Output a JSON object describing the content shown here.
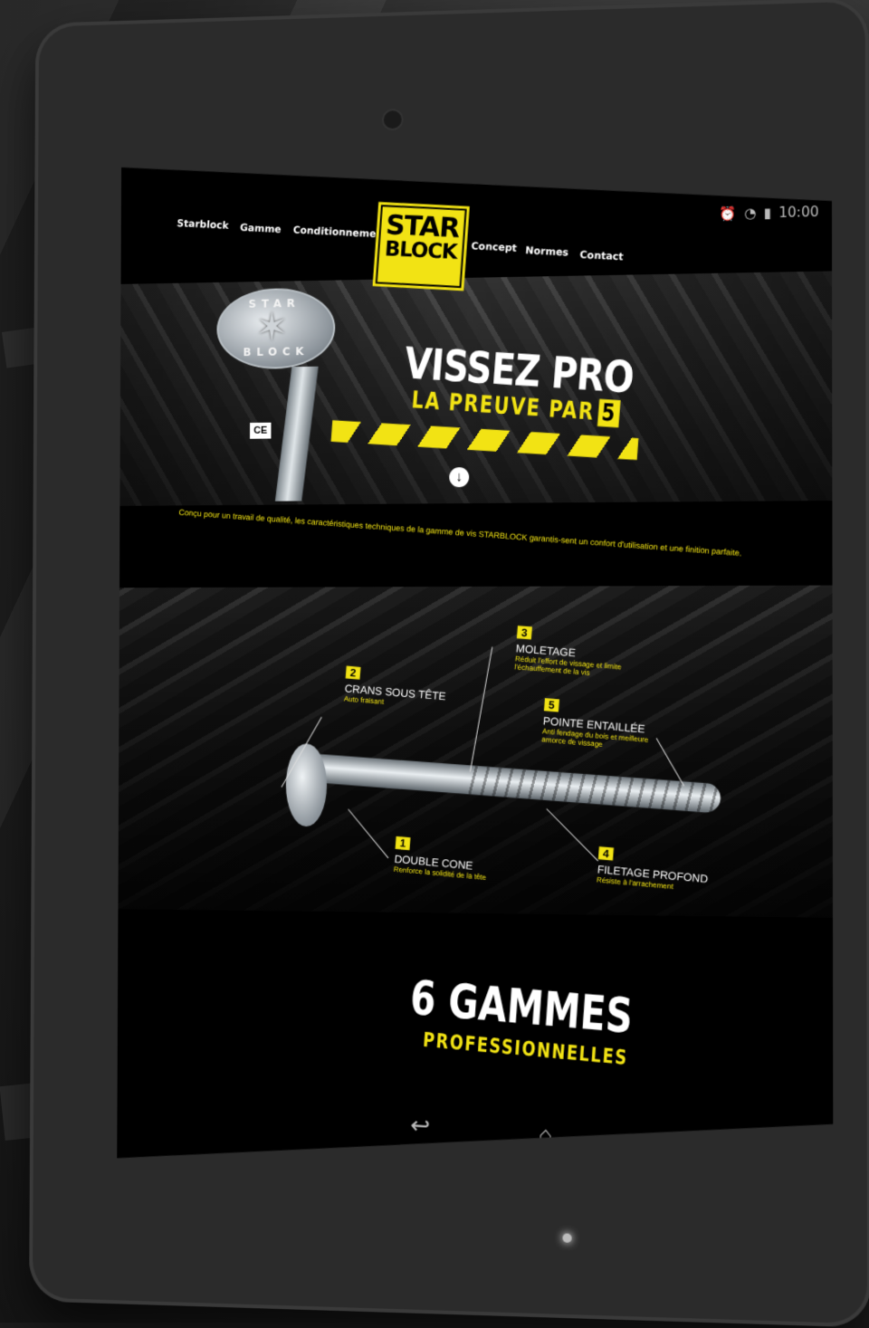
{
  "status_bar": {
    "time": "10:00"
  },
  "nav": {
    "left": [
      "Starblock",
      "Gamme",
      "Conditionnement"
    ],
    "right": [
      "Concept",
      "Normes",
      "Contact"
    ],
    "logo": {
      "line1": "STAR",
      "line2": "BLOCK"
    }
  },
  "hero": {
    "title": "VISSEZ PRO",
    "subtitle": "LA PREUVE PAR",
    "subtitle_number": "5",
    "screw_head_top": "STAR",
    "screw_head_bottom": "BLOCK",
    "ce_mark": "CE"
  },
  "intro": "Conçu pour un travail de qualité, les caractéristiques techniques de la gamme de vis STARBLOCK garantis-sent un confort d'utilisation et une finition parfaite.",
  "features": [
    {
      "num": "1",
      "title": "DOUBLE CONE",
      "desc": "Renforce la solidité de la tête"
    },
    {
      "num": "2",
      "title": "CRANS SOUS TÊTE",
      "desc": "Auto fraisant"
    },
    {
      "num": "3",
      "title": "MOLETAGE",
      "desc": "Réduit l'effort de vissage et limite l'échauffement de la vis"
    },
    {
      "num": "4",
      "title": "FILETAGE PROFOND",
      "desc": "Résiste à l'arrachement"
    },
    {
      "num": "5",
      "title": "POINTE ENTAILLÉE",
      "desc": "Anti fendage du bois et meilleure amorce de vissage"
    }
  ],
  "gammes": {
    "title": "6 GAMMES",
    "subtitle": "PROFESSIONNELLES"
  },
  "colors": {
    "accent": "#f2e314",
    "background": "#000000"
  },
  "system_nav": [
    "back-icon",
    "home-icon",
    "recents-icon"
  ]
}
